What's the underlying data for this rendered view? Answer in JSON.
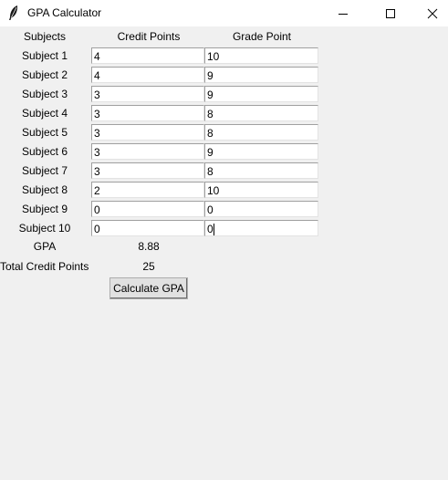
{
  "window": {
    "title": "GPA Calculator",
    "icon": "feather-icon"
  },
  "headers": {
    "subjects": "Subjects",
    "credit_points": "Credit Points",
    "grade_point": "Grade Point"
  },
  "rows": [
    {
      "label": "Subject 1",
      "credit": "4",
      "grade": "10"
    },
    {
      "label": "Subject 2",
      "credit": "4",
      "grade": "9"
    },
    {
      "label": "Subject 3",
      "credit": "3",
      "grade": "9"
    },
    {
      "label": "Subject 4",
      "credit": "3",
      "grade": "8"
    },
    {
      "label": "Subject 5",
      "credit": "3",
      "grade": "8"
    },
    {
      "label": "Subject 6",
      "credit": "3",
      "grade": "9"
    },
    {
      "label": "Subject 7",
      "credit": "3",
      "grade": "8"
    },
    {
      "label": "Subject 8",
      "credit": "2",
      "grade": "10"
    },
    {
      "label": "Subject 9",
      "credit": "0",
      "grade": "0"
    },
    {
      "label": "Subject 10",
      "credit": "0",
      "grade": "0"
    }
  ],
  "results": {
    "gpa_label": "GPA",
    "gpa_value": "8.88",
    "total_credits_label": "Total Credit Points",
    "total_credits_value": "25"
  },
  "actions": {
    "calculate_label": "Calculate GPA"
  }
}
